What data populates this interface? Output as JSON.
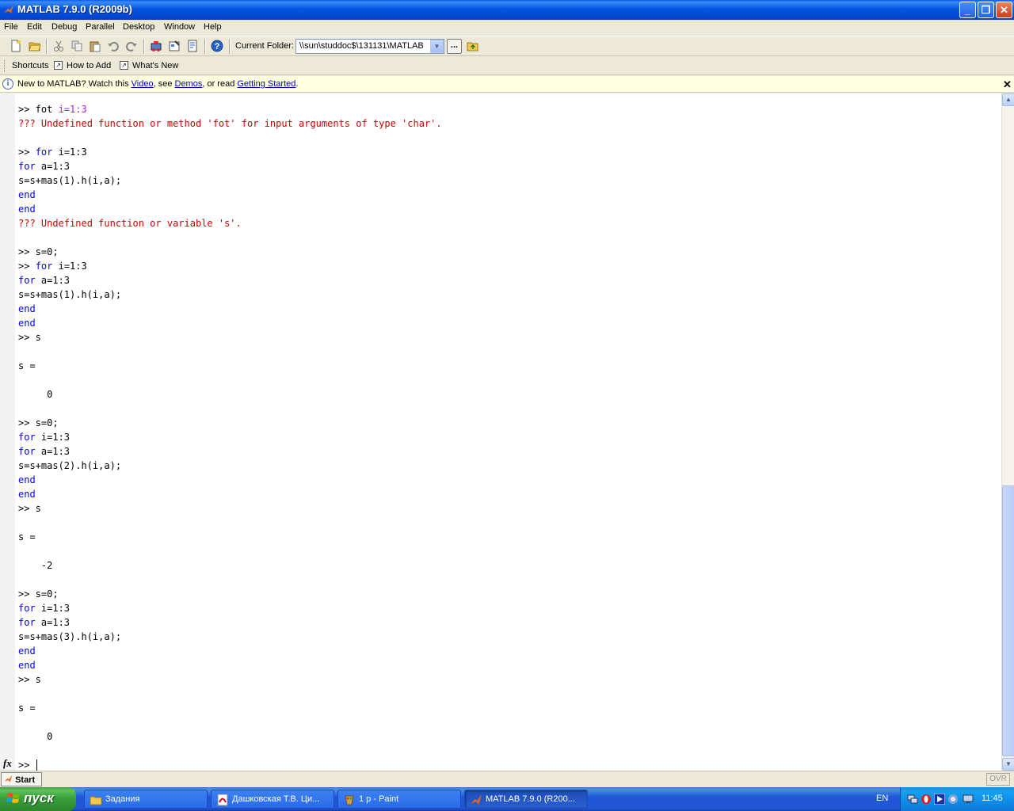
{
  "window": {
    "title": "MATLAB  7.9.0 (R2009b)",
    "minimize_glyph": "_",
    "maximize_glyph": "❐",
    "close_glyph": "✕"
  },
  "menu": [
    "File",
    "Edit",
    "Debug",
    "Parallel",
    "Desktop",
    "Window",
    "Help"
  ],
  "toolbar": {
    "current_folder_label": "Current Folder:",
    "current_folder_value": "\\\\sun\\studdoc$\\131131\\MATLAB",
    "browse_label": "..."
  },
  "shortcuts": {
    "label": "Shortcuts",
    "items": [
      "How to Add",
      "What's New"
    ]
  },
  "infobar": {
    "prefix": "New to MATLAB? Watch this ",
    "link_video": "Video",
    "mid1": ", see ",
    "link_demos": "Demos",
    "mid2": ", or read ",
    "link_started": "Getting Started",
    "suffix": ".",
    "close_glyph": "✕"
  },
  "command_window": {
    "lines": [
      [
        {
          "t": ">> fot ",
          "c": ""
        },
        {
          "t": "i=1:3",
          "c": "m"
        }
      ],
      [
        {
          "t": "??? Undefined function or method 'fot' for input arguments of type 'char'.",
          "c": "e"
        }
      ],
      [],
      [
        {
          "t": ">> ",
          "c": ""
        },
        {
          "t": "for",
          "c": "k"
        },
        {
          "t": " i=1:3",
          "c": ""
        }
      ],
      [
        {
          "t": "for",
          "c": "k"
        },
        {
          "t": " a=1:3",
          "c": ""
        }
      ],
      [
        {
          "t": "s=s+mas(1).h(i,a);",
          "c": ""
        }
      ],
      [
        {
          "t": "end",
          "c": "k"
        }
      ],
      [
        {
          "t": "end",
          "c": "k"
        }
      ],
      [
        {
          "t": "??? Undefined function or variable 's'.",
          "c": "e"
        }
      ],
      [],
      [
        {
          "t": ">> s=0;",
          "c": ""
        }
      ],
      [
        {
          "t": ">> ",
          "c": ""
        },
        {
          "t": "for",
          "c": "k"
        },
        {
          "t": " i=1:3",
          "c": ""
        }
      ],
      [
        {
          "t": "for",
          "c": "k"
        },
        {
          "t": " a=1:3",
          "c": ""
        }
      ],
      [
        {
          "t": "s=s+mas(1).h(i,a);",
          "c": ""
        }
      ],
      [
        {
          "t": "end",
          "c": "k"
        }
      ],
      [
        {
          "t": "end",
          "c": "k"
        }
      ],
      [
        {
          "t": ">> s",
          "c": ""
        }
      ],
      [],
      [
        {
          "t": "s =",
          "c": ""
        }
      ],
      [],
      [
        {
          "t": "     0",
          "c": ""
        }
      ],
      [],
      [
        {
          "t": ">> s=0;",
          "c": ""
        }
      ],
      [
        {
          "t": "for",
          "c": "k"
        },
        {
          "t": " i=1:3",
          "c": ""
        }
      ],
      [
        {
          "t": "for",
          "c": "k"
        },
        {
          "t": " a=1:3",
          "c": ""
        }
      ],
      [
        {
          "t": "s=s+mas(2).h(i,a);",
          "c": ""
        }
      ],
      [
        {
          "t": "end",
          "c": "k"
        }
      ],
      [
        {
          "t": "end",
          "c": "k"
        }
      ],
      [
        {
          "t": ">> s",
          "c": ""
        }
      ],
      [],
      [
        {
          "t": "s =",
          "c": ""
        }
      ],
      [],
      [
        {
          "t": "    -2",
          "c": ""
        }
      ],
      [],
      [
        {
          "t": ">> s=0;",
          "c": ""
        }
      ],
      [
        {
          "t": "for",
          "c": "k"
        },
        {
          "t": " i=1:3",
          "c": ""
        }
      ],
      [
        {
          "t": "for",
          "c": "k"
        },
        {
          "t": " a=1:3",
          "c": ""
        }
      ],
      [
        {
          "t": "s=s+mas(3).h(i,a);",
          "c": ""
        }
      ],
      [
        {
          "t": "end",
          "c": "k"
        }
      ],
      [
        {
          "t": "end",
          "c": "k"
        }
      ],
      [
        {
          "t": ">> s",
          "c": ""
        }
      ],
      [],
      [
        {
          "t": "s =",
          "c": ""
        }
      ],
      [],
      [
        {
          "t": "     0",
          "c": ""
        }
      ],
      [],
      [
        {
          "t": ">> ",
          "c": ""
        },
        {
          "t": "|",
          "c": "cur"
        }
      ]
    ],
    "fx_label": "fx"
  },
  "statusbar": {
    "start_label": "Start",
    "ovr_label": "OVR"
  },
  "taskbar": {
    "start_label": "пуск",
    "tasks": [
      {
        "label": "Задания",
        "icon": "folder-icon"
      },
      {
        "label": "Дашковская Т.В. Ци...",
        "icon": "pdf-icon"
      },
      {
        "label": "1 p - Paint",
        "icon": "paint-icon"
      },
      {
        "label": "MATLAB  7.9.0 (R200...",
        "icon": "matlab-icon"
      }
    ],
    "language": "EN",
    "clock": "11:45"
  },
  "colors": {
    "keyword": "#0000ff",
    "error": "#cc0000",
    "string_purple": "#a020f0"
  }
}
